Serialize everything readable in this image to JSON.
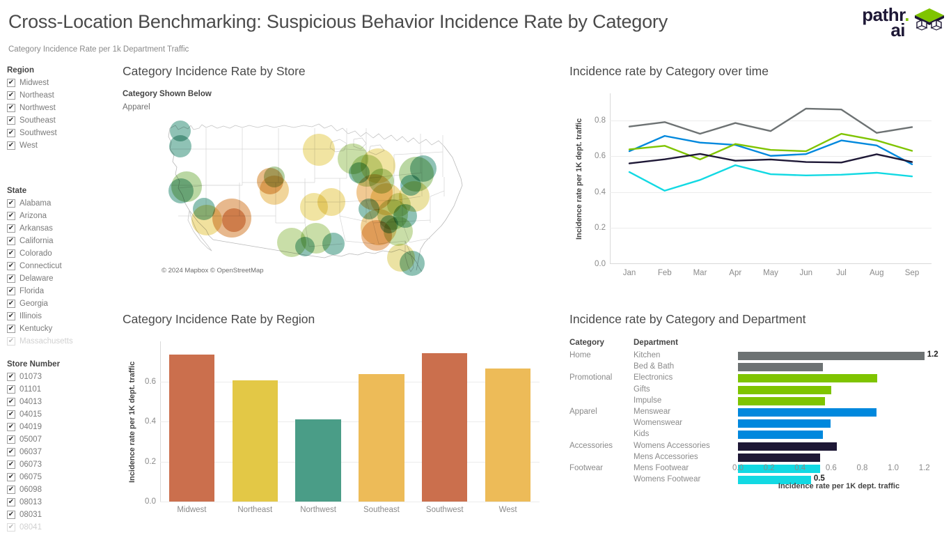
{
  "header": {
    "title": "Cross-Location Benchmarking: Suspicious Behavior Incidence Rate by Category",
    "subtitle": "Category Incidence Rate per 1k Department Traffic",
    "logo_line1": "pathr",
    "logo_dot": ".",
    "logo_line2": "ai"
  },
  "filters": {
    "region": {
      "title": "Region",
      "items": [
        "Midwest",
        "Northeast",
        "Northwest",
        "Southeast",
        "Southwest",
        "West"
      ]
    },
    "state": {
      "title": "State",
      "items": [
        "Alabama",
        "Arizona",
        "Arkansas",
        "California",
        "Colorado",
        "Connecticut",
        "Delaware",
        "Florida",
        "Georgia",
        "Illinois",
        "Kentucky",
        "Massachusetts"
      ]
    },
    "store_number": {
      "title": "Store Number",
      "items": [
        "01073",
        "01101",
        "04013",
        "04015",
        "04019",
        "05007",
        "06037",
        "06073",
        "06075",
        "06098",
        "08013",
        "08031",
        "08041"
      ]
    },
    "checkmark": "✔"
  },
  "map_panel": {
    "title": "Category Incidence Rate by Store",
    "legend_header": "Category Shown Below",
    "legend_value": "Apparel",
    "attribution": "© 2024 Mapbox © OpenStreetMap"
  },
  "chart_data": [
    {
      "id": "region_bar",
      "type": "bar",
      "title": "Category Incidence Rate by Region",
      "xlabel": "",
      "ylabel": "Incidence rate per 1K dept. traffic",
      "ylim": [
        0,
        0.8
      ],
      "yticks": [
        0.0,
        0.2,
        0.4,
        0.6
      ],
      "grid": true,
      "categories": [
        "Midwest",
        "Northeast",
        "Northwest",
        "Southeast",
        "Southwest",
        "West"
      ],
      "values": [
        0.735,
        0.605,
        0.41,
        0.635,
        0.74,
        0.665
      ],
      "colors": [
        "#cb6f4d",
        "#e3c846",
        "#4a9d87",
        "#edbb58",
        "#cb6f4d",
        "#edbb58"
      ]
    },
    {
      "id": "category_over_time",
      "type": "line",
      "title": "Incidence rate by Category over time",
      "xlabel": "",
      "ylabel": "Incidence rate per 1K dept. traffic",
      "ylim": [
        0,
        0.95
      ],
      "yticks": [
        0.0,
        0.2,
        0.4,
        0.6,
        0.8
      ],
      "grid": true,
      "x": [
        "Jan",
        "Feb",
        "Mar",
        "Apr",
        "May",
        "Jun",
        "Jul",
        "Aug",
        "Sep"
      ],
      "series": [
        {
          "name": "Home",
          "color": "#6d7273",
          "values": [
            0.765,
            0.79,
            0.725,
            0.785,
            0.74,
            0.865,
            0.86,
            0.73,
            0.762
          ]
        },
        {
          "name": "Apparel",
          "color": "#0088dd",
          "values": [
            0.628,
            0.713,
            0.676,
            0.663,
            0.602,
            0.612,
            0.688,
            0.66,
            0.555
          ]
        },
        {
          "name": "Promotional",
          "color": "#7fc400",
          "values": [
            0.638,
            0.658,
            0.582,
            0.668,
            0.635,
            0.628,
            0.725,
            0.688,
            0.63
          ]
        },
        {
          "name": "Accessories",
          "color": "#1e1836",
          "values": [
            0.56,
            0.583,
            0.613,
            0.575,
            0.582,
            0.568,
            0.565,
            0.611,
            0.568
          ]
        },
        {
          "name": "Footwear",
          "color": "#12d9e3",
          "values": [
            0.512,
            0.408,
            0.468,
            0.55,
            0.5,
            0.493,
            0.497,
            0.508,
            0.488
          ]
        }
      ]
    },
    {
      "id": "category_department_bar",
      "type": "bar",
      "orientation": "horizontal",
      "title": "Incidence rate by Category and Department",
      "col_header_category": "Category",
      "col_header_department": "Department",
      "xlabel": "Incidence rate per 1K dept. traffic",
      "ylabel": "",
      "xlim": [
        0,
        1.3
      ],
      "xticks": [
        0.0,
        0.2,
        0.4,
        0.6,
        0.8,
        1.0,
        1.2
      ],
      "rows": [
        {
          "category": "Home",
          "department": "Kitchen",
          "value": 1.2,
          "color": "#6d7273",
          "label": "1.2"
        },
        {
          "category": "",
          "department": "Bed & Bath",
          "value": 0.545,
          "color": "#6d7273",
          "label": ""
        },
        {
          "category": "Promotional",
          "department": "Electronics",
          "value": 0.895,
          "color": "#7fc400",
          "label": ""
        },
        {
          "category": "",
          "department": "Gifts",
          "value": 0.6,
          "color": "#7fc400",
          "label": ""
        },
        {
          "category": "",
          "department": "Impulse",
          "value": 0.56,
          "color": "#7fc400",
          "label": ""
        },
        {
          "category": "Apparel",
          "department": "Menswear",
          "value": 0.89,
          "color": "#0088dd",
          "label": ""
        },
        {
          "category": "",
          "department": "Womenswear",
          "value": 0.595,
          "color": "#0088dd",
          "label": ""
        },
        {
          "category": "",
          "department": "Kids",
          "value": 0.545,
          "color": "#0088dd",
          "label": ""
        },
        {
          "category": "Accessories",
          "department": "Womens Accessories",
          "value": 0.635,
          "color": "#1e1836",
          "label": ""
        },
        {
          "category": "",
          "department": "Mens Accessories",
          "value": 0.53,
          "color": "#1e1836",
          "label": ""
        },
        {
          "category": "Footwear",
          "department": "Mens Footwear",
          "value": 0.528,
          "color": "#12d9e3",
          "label": ""
        },
        {
          "category": "",
          "department": "Womens Footwear",
          "value": 0.47,
          "color": "#12d9e3",
          "label": "0.5"
        }
      ]
    }
  ],
  "map_bubbles": [
    {
      "x": 33,
      "y": 18,
      "r": 15,
      "color": "#4a9d87"
    },
    {
      "x": 33,
      "y": 40,
      "r": 16,
      "color": "#4a9d87"
    },
    {
      "x": 42,
      "y": 98,
      "r": 22,
      "color": "#8fbf6a"
    },
    {
      "x": 34,
      "y": 104,
      "r": 18,
      "color": "#4a9d87"
    },
    {
      "x": 67,
      "y": 130,
      "r": 16,
      "color": "#4a9d87"
    },
    {
      "x": 71,
      "y": 146,
      "r": 22,
      "color": "#e9cf62"
    },
    {
      "x": 107,
      "y": 143,
      "r": 28,
      "color": "#d98c46"
    },
    {
      "x": 110,
      "y": 146,
      "r": 17,
      "color": "#d47a3e"
    },
    {
      "x": 162,
      "y": 90,
      "r": 19,
      "color": "#d9913f"
    },
    {
      "x": 168,
      "y": 103,
      "r": 21,
      "color": "#e9bb5c"
    },
    {
      "x": 168,
      "y": 84,
      "r": 15,
      "color": "#88b36a"
    },
    {
      "x": 228,
      "y": 172,
      "r": 22,
      "color": "#a8c972"
    },
    {
      "x": 253,
      "y": 180,
      "r": 16,
      "color": "#4a9d87"
    },
    {
      "x": 250,
      "y": 120,
      "r": 20,
      "color": "#e9cf62"
    },
    {
      "x": 232,
      "y": 45,
      "r": 23,
      "color": "#e9d468"
    },
    {
      "x": 281,
      "y": 58,
      "r": 22,
      "color": "#a8c972"
    },
    {
      "x": 290,
      "y": 78,
      "r": 15,
      "color": "#4a9d87"
    },
    {
      "x": 301,
      "y": 75,
      "r": 23,
      "color": "#a8c972"
    },
    {
      "x": 317,
      "y": 68,
      "r": 25,
      "color": "#e9d468"
    },
    {
      "x": 322,
      "y": 90,
      "r": 18,
      "color": "#8fbf6a"
    },
    {
      "x": 312,
      "y": 106,
      "r": 26,
      "color": "#e8a751"
    },
    {
      "x": 304,
      "y": 130,
      "r": 15,
      "color": "#4a9d87"
    },
    {
      "x": 329,
      "y": 116,
      "r": 23,
      "color": "#e9c95f"
    },
    {
      "x": 347,
      "y": 124,
      "r": 17,
      "color": "#b9cf78"
    },
    {
      "x": 338,
      "y": 138,
      "r": 22,
      "color": "#a8c972"
    },
    {
      "x": 356,
      "y": 140,
      "r": 17,
      "color": "#4a9d87"
    },
    {
      "x": 318,
      "y": 156,
      "r": 26,
      "color": "#e9b85a"
    },
    {
      "x": 315,
      "y": 168,
      "r": 22,
      "color": "#e09450"
    },
    {
      "x": 333,
      "y": 152,
      "r": 13,
      "color": "#4a9d87"
    },
    {
      "x": 346,
      "y": 162,
      "r": 21,
      "color": "#a8c972"
    },
    {
      "x": 369,
      "y": 112,
      "r": 22,
      "color": "#dfd06a"
    },
    {
      "x": 364,
      "y": 96,
      "r": 15,
      "color": "#3f9b9a"
    },
    {
      "x": 372,
      "y": 80,
      "r": 25,
      "color": "#8fbf6a"
    },
    {
      "x": 382,
      "y": 72,
      "r": 19,
      "color": "#4a9d87"
    },
    {
      "x": 350,
      "y": 200,
      "r": 20,
      "color": "#dfd06a"
    },
    {
      "x": 366,
      "y": 208,
      "r": 18,
      "color": "#4a9d87"
    },
    {
      "x": 193,
      "y": 178,
      "r": 21,
      "color": "#a8c972"
    },
    {
      "x": 212,
      "y": 184,
      "r": 14,
      "color": "#4a9d87"
    },
    {
      "x": 225,
      "y": 127,
      "r": 20,
      "color": "#e9d468"
    }
  ]
}
